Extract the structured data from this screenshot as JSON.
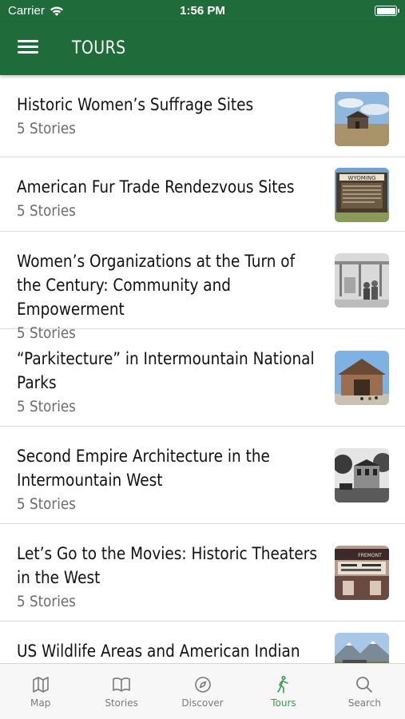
{
  "status_bar": {
    "carrier": "Carrier",
    "time": "1:56 PM"
  },
  "header": {
    "title": "TOURS"
  },
  "tours": [
    {
      "title": "Historic Women’s Suffrage Sites",
      "subtitle": "5 Stories"
    },
    {
      "title": "American Fur Trade Rendezvous Sites",
      "subtitle": "5 Stories",
      "sign_text": "WYOMING"
    },
    {
      "title": "Women’s Organizations at the Turn of the Century: Community and Empowerment",
      "subtitle": "5 Stories"
    },
    {
      "title": "“Parkitecture” in Intermountain National Parks",
      "subtitle": "5 Stories"
    },
    {
      "title": "Second Empire Architecture in the Intermountain West",
      "subtitle": "5 Stories"
    },
    {
      "title": "Let’s Go to the Movies: Historic Theaters in the West",
      "subtitle": "5 Stories",
      "marquee_text": "FREMONT"
    },
    {
      "title": "US Wildlife Areas and American Indian Lands",
      "subtitle": ""
    }
  ],
  "tab_bar": {
    "active": "Tours",
    "tabs": [
      {
        "label": "Map",
        "icon": "map-icon"
      },
      {
        "label": "Stories",
        "icon": "book-icon"
      },
      {
        "label": "Discover",
        "icon": "compass-icon"
      },
      {
        "label": "Tours",
        "icon": "walker-icon"
      },
      {
        "label": "Search",
        "icon": "search-icon"
      }
    ]
  },
  "colors": {
    "brand_green": "#1f6b3a",
    "active_tab": "#3a9a4f",
    "inactive_tab": "#7a7a7a"
  }
}
